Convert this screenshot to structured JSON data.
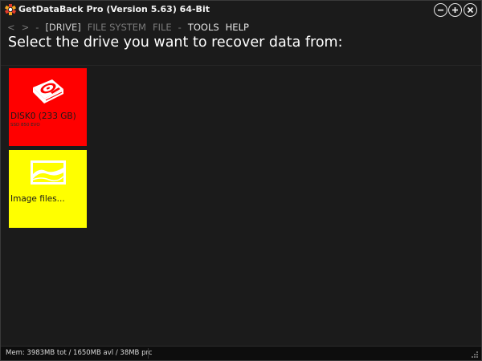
{
  "window": {
    "title": "GetDataBack Pro (Version 5.63) 64-Bit"
  },
  "menu": {
    "back": "<",
    "forward": ">",
    "dash1": "-",
    "drive": "[DRIVE]",
    "file_system": "FILE SYSTEM",
    "file": "FILE",
    "dash2": "-",
    "tools": "TOOLS",
    "help": "HELP"
  },
  "heading": "Select the drive you want to recover data from:",
  "tiles": [
    {
      "label": "DISK0 (233 GB)",
      "sublabel": "SSD 850 EVO",
      "icon": "hard-disk-icon",
      "color": "#ff0000"
    },
    {
      "label": "Image files...",
      "icon": "image-file-icon",
      "color": "#ffff00"
    }
  ],
  "status": {
    "memory": "Mem: 3983MB tot / 1650MB avl / 38MB prc"
  },
  "colors": {
    "background": "#1b1b1b",
    "text": "#ffffff",
    "disabled_text": "#7a7a7a"
  }
}
